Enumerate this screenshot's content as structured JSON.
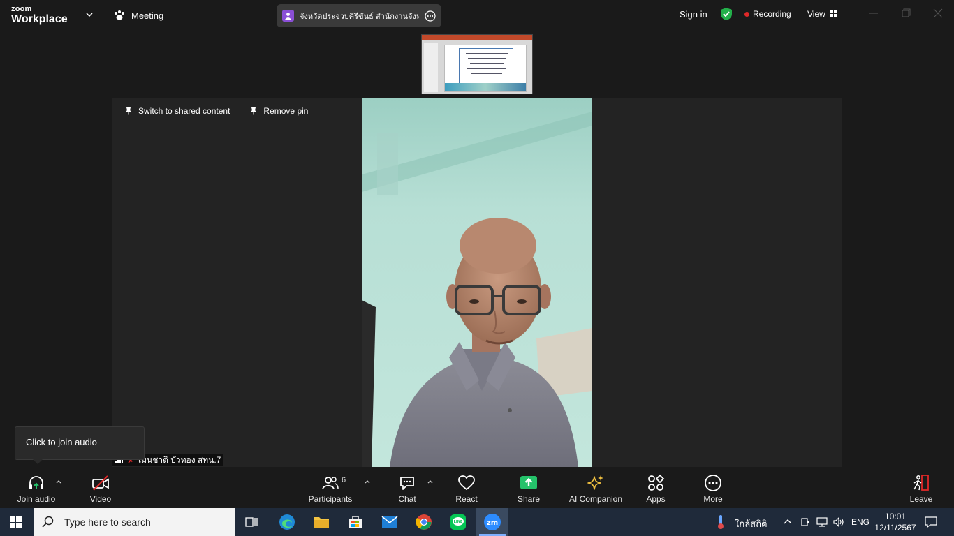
{
  "titlebar": {
    "logo_line1": "zoom",
    "logo_line2": "Workplace",
    "meeting_label": "Meeting",
    "meeting_title": "จังหวัดประจวบคีรีขันธ์ สำนักงานจังหวัด",
    "sign_in": "Sign in",
    "recording": "Recording",
    "view": "View"
  },
  "stage": {
    "switch_label": "Switch to shared content",
    "remove_pin_label": "Remove pin",
    "participant_name": "เมนชาติ บัวทอง สทน.7"
  },
  "tooltip": {
    "text": "Click to join audio"
  },
  "toolbar": {
    "join_audio": "Join audio",
    "video": "Video",
    "participants": "Participants",
    "participants_count": "6",
    "chat": "Chat",
    "react": "React",
    "share": "Share",
    "ai_companion": "AI Companion",
    "apps": "Apps",
    "more": "More",
    "leave": "Leave"
  },
  "taskbar": {
    "search_placeholder": "Type here to search",
    "weather": "ใกล้สถิติ",
    "language": "ENG",
    "time": "10:01",
    "date": "12/11/2567"
  },
  "colors": {
    "share_green": "#24c26a",
    "recording_red": "#e02828",
    "shield_green": "#23b04a",
    "taskbar_bg": "#1f2a3a"
  }
}
